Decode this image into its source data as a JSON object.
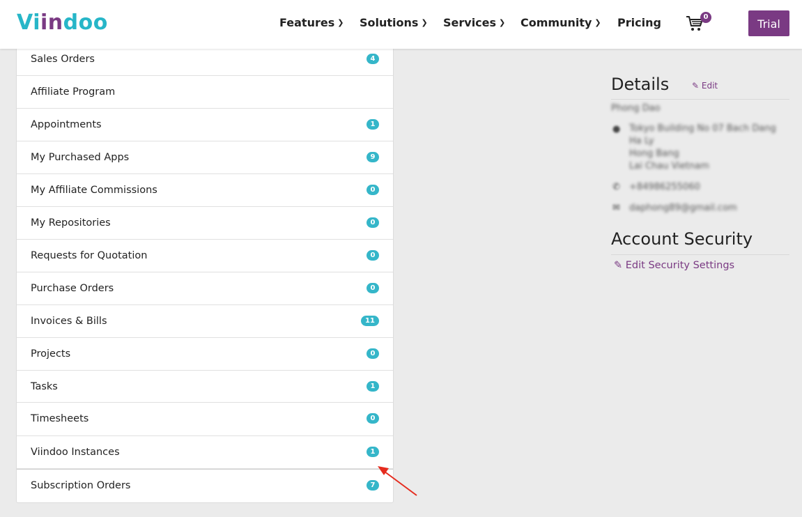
{
  "header": {
    "logo_part1": "Vi",
    "logo_part2": "in",
    "logo_part3": "doo",
    "nav": [
      {
        "label": "Features"
      },
      {
        "label": "Solutions"
      },
      {
        "label": "Services"
      },
      {
        "label": "Community"
      },
      {
        "label": "Pricing"
      }
    ],
    "cart_count": "0",
    "trial_label": "Trial"
  },
  "menu": {
    "items": [
      {
        "label": "Sales Orders",
        "count": "4"
      },
      {
        "label": "Affiliate Program",
        "count": ""
      },
      {
        "label": "Appointments",
        "count": "1"
      },
      {
        "label": "My Purchased Apps",
        "count": "9"
      },
      {
        "label": "My Affiliate Commissions",
        "count": "0"
      },
      {
        "label": "My Repositories",
        "count": "0"
      },
      {
        "label": "Requests for Quotation",
        "count": "0"
      },
      {
        "label": "Purchase Orders",
        "count": "0"
      },
      {
        "label": "Invoices & Bills",
        "count": "11"
      },
      {
        "label": "Projects",
        "count": "0"
      },
      {
        "label": "Tasks",
        "count": "1"
      },
      {
        "label": "Timesheets",
        "count": "0"
      },
      {
        "label": "Viindoo Instances",
        "count": "1"
      },
      {
        "label": "Subscription Orders",
        "count": "7"
      }
    ]
  },
  "details": {
    "title": "Details",
    "edit_label": "Edit",
    "name": "Phong Dao",
    "address_lines": [
      "Tokyo Building No 07 Bach Dang",
      "Ha Ly",
      "Hong Bang",
      "Lai Chau Vietnam"
    ],
    "phone": "+84986255060",
    "email": "daphong89@gmail.com"
  },
  "security": {
    "title": "Account Security",
    "edit_label": "Edit Security Settings"
  },
  "colors": {
    "brand_purple": "#7a3a83",
    "brand_teal": "#27b6c8",
    "badge": "#35b6c9",
    "annotation_arrow": "#e52b1e"
  }
}
